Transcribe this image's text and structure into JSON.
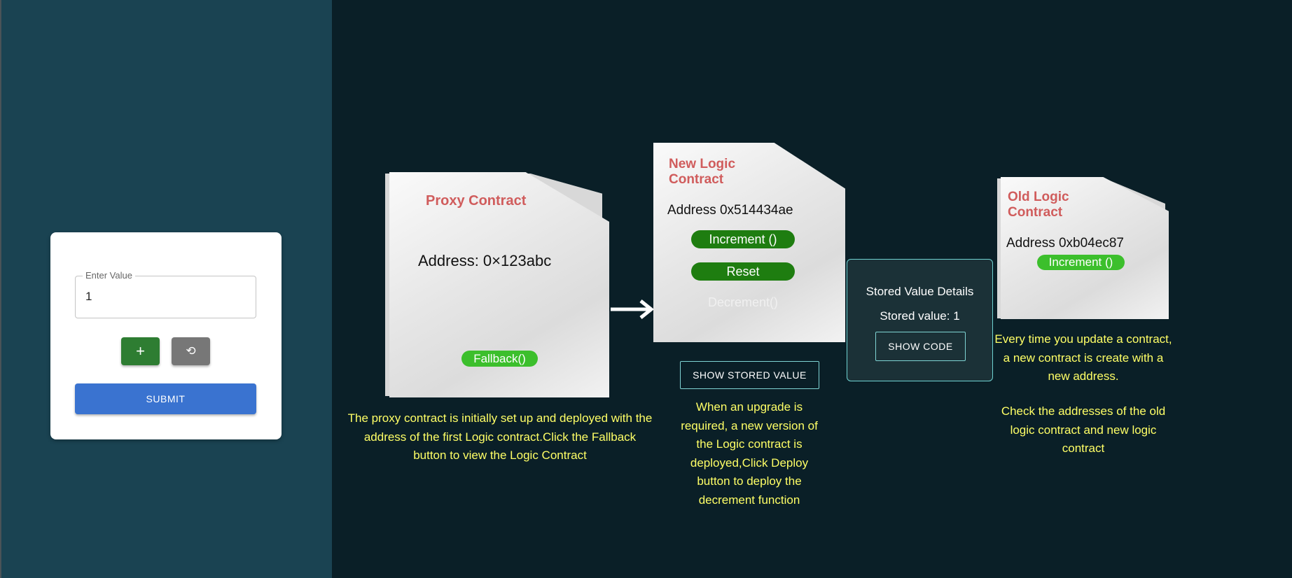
{
  "form": {
    "field_label": "Enter Value",
    "field_value": "1",
    "plus_label": "+",
    "reset_label": "⟲",
    "submit_label": "SUBMIT"
  },
  "proxy": {
    "title": "Proxy Contract",
    "address": "Address: 0×123abc",
    "fallback_label": "Fallback()",
    "caption": "The proxy contract is initially set up and deployed with the address of the first Logic contract.Click the Fallback button to view the Logic Contract"
  },
  "new_logic": {
    "title": "New  Logic Contract",
    "address": "Address 0x514434ae",
    "increment_label": "Increment ()",
    "reset_label": "Reset",
    "decrement_label": "Decrement()",
    "show_stored_label": "SHOW STORED VALUE",
    "caption": "When an upgrade is required, a new version of the Logic contract is deployed,Click Deploy button to deploy the decrement function"
  },
  "stored": {
    "title": "Stored Value Details",
    "value_text": "Stored value: 1",
    "show_code_label": "SHOW CODE"
  },
  "old_logic": {
    "title": "Old  Logic Contract",
    "address": "Address 0xb04ec87",
    "increment_label": "Increment ()",
    "caption1": "Every time you update a contract, a new contract is create with a new address.",
    "caption2": "Check the addresses of the old logic contract and new logic contract"
  },
  "colors": {
    "left_bg": "#1a4352",
    "right_bg": "#0a1f27",
    "caption": "#ffff66",
    "title_red": "#d05c5c",
    "pill_green": "#1e7d10",
    "pill_bright_green": "#3cbf2c",
    "submit_blue": "#3a73d0"
  }
}
